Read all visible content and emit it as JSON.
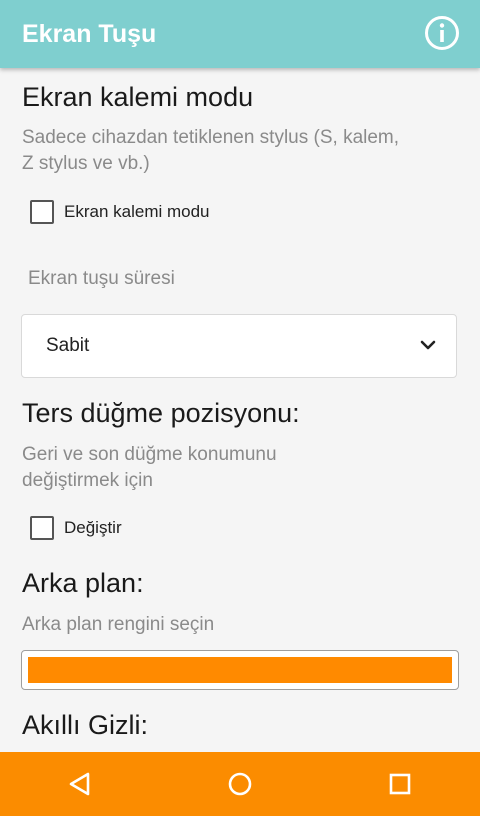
{
  "appbar": {
    "title": "Ekran Tuşu",
    "info_icon": "info-icon"
  },
  "pen_mode": {
    "heading": "Ekran kalemi modu",
    "description_line1": "Sadece cihazdan tetiklenen stylus (S, kalem,",
    "description_line2": "Z stylus ve vb.)",
    "checkbox_label": "Ekran kalemi modu",
    "checked": false
  },
  "duration": {
    "label": "Ekran tuşu süresi",
    "selected": "Sabit",
    "dropdown_icon": "chevron-down-icon"
  },
  "reverse_buttons": {
    "heading": "Ters düğme pozisyonu:",
    "description_line1": "Geri ve son düğme konumunu",
    "description_line2": "değiştirmek için",
    "checkbox_label": "Değiştir",
    "checked": false
  },
  "background": {
    "heading": "Arka plan:",
    "description": "Arka plan rengini seçin",
    "color": "#ff8a00"
  },
  "smart_hide": {
    "heading": "Akıllı Gizli:"
  },
  "navbar": {
    "color": "#fb8c00",
    "buttons": [
      "back-triangle-icon",
      "home-circle-icon",
      "recents-square-icon"
    ]
  }
}
